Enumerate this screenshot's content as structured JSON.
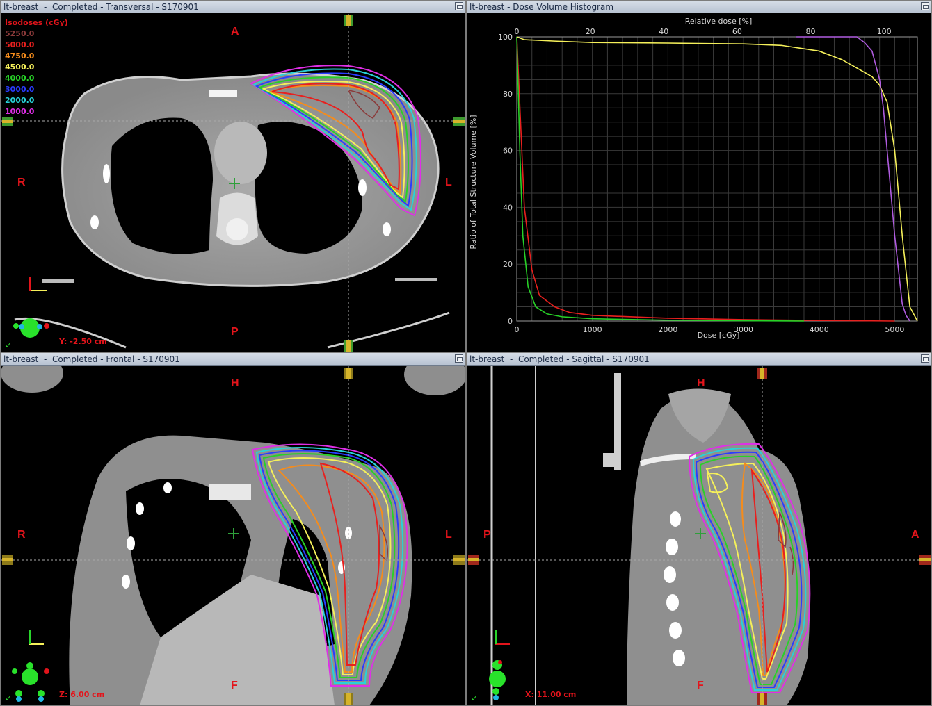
{
  "panels": {
    "transversal": {
      "title": "lt-breast  -  Completed - Transversal - S170901",
      "orient_top": "A",
      "orient_bottom": "P",
      "orient_left": "R",
      "orient_right": "L",
      "coord": "Y: -2.50 cm"
    },
    "dvh": {
      "title": "lt-breast - Dose Volume Histogram"
    },
    "frontal": {
      "title": "lt-breast  -  Completed - Frontal - S170901",
      "orient_top": "H",
      "orient_bottom": "F",
      "orient_left": "R",
      "orient_right": "L",
      "coord": "Z: 6.00 cm"
    },
    "sagittal": {
      "title": "lt-breast  -  Completed - Sagittal - S170901",
      "orient_top": "H",
      "orient_bottom": "F",
      "orient_left": "P",
      "orient_right": "A",
      "coord": "X: 11.00 cm"
    }
  },
  "check_mark": "✓",
  "isodoses": {
    "title": "Isodoses (cGy)",
    "levels": [
      {
        "value": "5250.0",
        "color": "#8b3a3a"
      },
      {
        "value": "5000.0",
        "color": "#e8201e"
      },
      {
        "value": "4750.0",
        "color": "#f58c1c"
      },
      {
        "value": "4500.0",
        "color": "#f5f05a"
      },
      {
        "value": "4000.0",
        "color": "#27d127"
      },
      {
        "value": "3000.0",
        "color": "#2a3cff"
      },
      {
        "value": "2000.0",
        "color": "#28d2d8"
      },
      {
        "value": "1000.0",
        "color": "#e02ee8"
      }
    ]
  },
  "chart_data": {
    "type": "line",
    "xlabel": "Dose [cGy]",
    "x2label": "Relative dose [%]",
    "ylabel": "Ratio of Total Structure Volume [%]",
    "xlim": [
      0,
      5300
    ],
    "ylim": [
      0,
      100
    ],
    "x_ticks": [
      0,
      1000,
      2000,
      3000,
      4000,
      5000
    ],
    "x2_ticks": [
      0,
      20,
      40,
      60,
      80,
      100
    ],
    "y_ticks": [
      0,
      20,
      40,
      60,
      80,
      100
    ],
    "grid": true,
    "series": [
      {
        "color": "#f5f05a",
        "x": [
          0,
          100,
          500,
          1000,
          2000,
          3000,
          3500,
          4000,
          4300,
          4500,
          4700,
          4800,
          4900,
          5000,
          5100,
          5200,
          5300
        ],
        "y": [
          100,
          99,
          98.5,
          98,
          97.8,
          97.5,
          97,
          95,
          92,
          89,
          86,
          83,
          77,
          60,
          30,
          5,
          0
        ]
      },
      {
        "color": "#b05ce0",
        "x": [
          3700,
          4500,
          4600,
          4700,
          4800,
          4850,
          4900,
          5000,
          5100,
          5150,
          5200
        ],
        "y": [
          100,
          100,
          98,
          95,
          85,
          75,
          60,
          30,
          6,
          2,
          0
        ]
      },
      {
        "color": "#e8201e",
        "x": [
          0,
          50,
          100,
          200,
          300,
          500,
          700,
          1000,
          2000,
          3000,
          4000,
          5000
        ],
        "y": [
          100,
          70,
          40,
          18,
          9,
          5,
          3,
          2,
          1,
          0.5,
          0.2,
          0
        ]
      },
      {
        "color": "#27d127",
        "x": [
          0,
          40,
          80,
          150,
          250,
          400,
          600,
          1000,
          2000,
          3000,
          3800
        ],
        "y": [
          100,
          60,
          30,
          12,
          5,
          2.5,
          1.5,
          0.8,
          0.3,
          0.1,
          0
        ]
      }
    ]
  }
}
